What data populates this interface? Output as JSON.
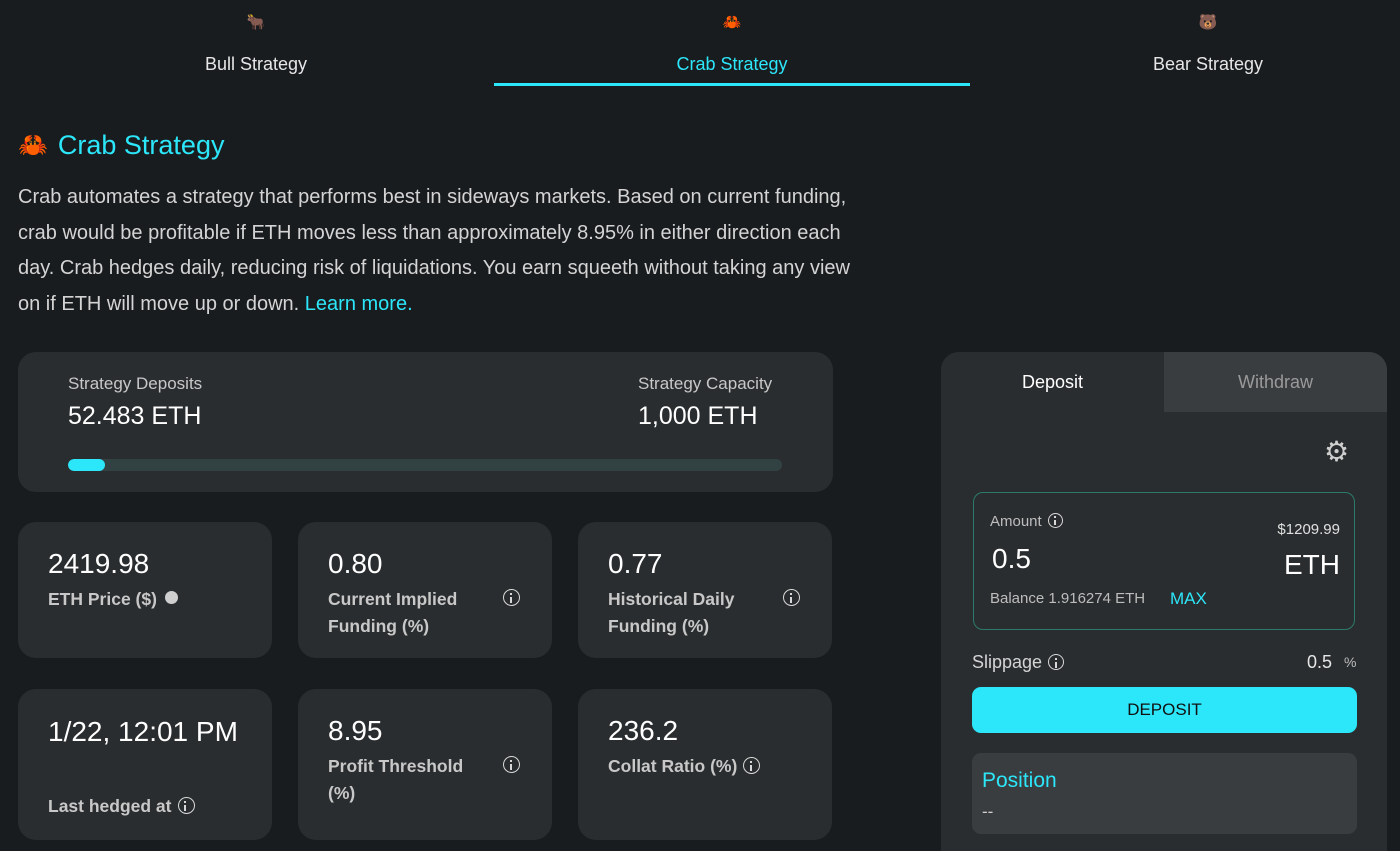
{
  "tabs": [
    {
      "emoji": "🐂",
      "label": "Bull Strategy"
    },
    {
      "emoji": "🦀",
      "label": "Crab Strategy"
    },
    {
      "emoji": "🐻",
      "label": "Bear Strategy"
    }
  ],
  "active_tab": "Crab Strategy",
  "heading": {
    "emoji": "🦀",
    "title": "Crab Strategy"
  },
  "description": {
    "text": "Crab automates a strategy that performs best in sideways markets. Based on current funding, crab would be profitable if ETH moves less than approximately 8.95% in either direction each day. Crab hedges daily, reducing risk of liquidations. You earn squeeth without taking any view on if ETH will move up or down.",
    "link": "Learn more."
  },
  "capacity": {
    "deposits_label": "Strategy Deposits",
    "deposits_value": "52.483 ETH",
    "capacity_label": "Strategy Capacity",
    "capacity_value": "1,000 ETH",
    "progress_fraction": 0.052483
  },
  "stats": {
    "eth_price": {
      "value": "2419.98",
      "label": "ETH Price ($)"
    },
    "implied_funding": {
      "value": "0.80",
      "label": "Current Implied Funding (%)"
    },
    "historical_funding": {
      "value": "0.77",
      "label": "Historical Daily Funding (%)"
    },
    "last_hedged": {
      "value": "1/22, 12:01 PM",
      "label": "Last hedged at"
    },
    "profit_threshold": {
      "value": "8.95",
      "label": "Profit Threshold (%)"
    },
    "collat_ratio": {
      "value": "236.2",
      "label": "Collat Ratio (%)"
    }
  },
  "panel": {
    "tab_deposit": "Deposit",
    "tab_withdraw": "Withdraw",
    "gear_icon": "gear-icon",
    "amount_label": "Amount",
    "amount_value": "0.5",
    "amount_usd": "$1209.99",
    "amount_unit": "ETH",
    "balance": "Balance 1.916274 ETH",
    "max_label": "MAX",
    "slippage_label": "Slippage",
    "slippage_value": "0.5",
    "slippage_unit": "%",
    "deposit_button": "DEPOSIT",
    "position_title": "Position",
    "position_value": "--"
  },
  "colors": {
    "accent": "#2ce6f9",
    "background": "#191c1f",
    "card": "#2a2d2f"
  }
}
